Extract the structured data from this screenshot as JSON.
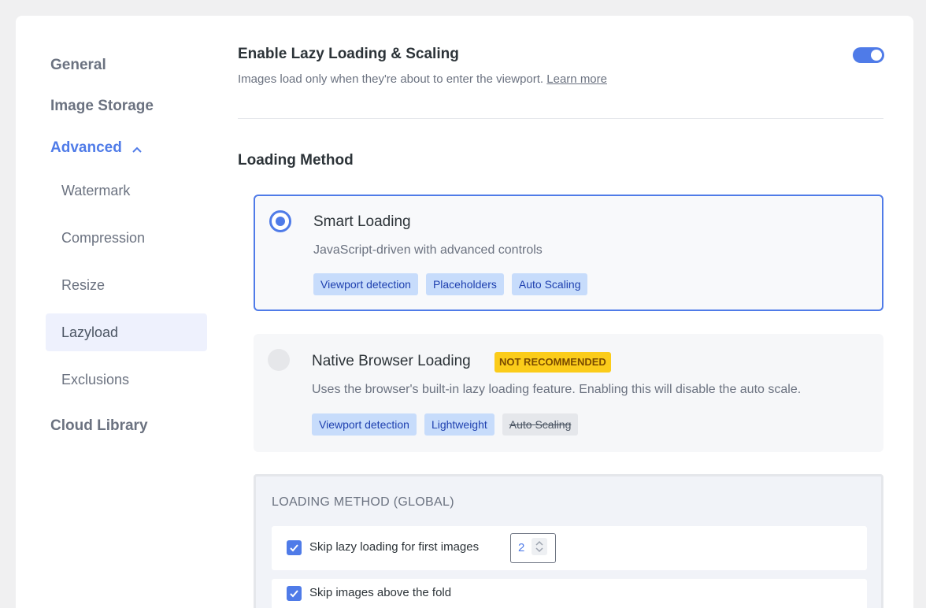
{
  "sidebar": {
    "general": "General",
    "image_storage": "Image Storage",
    "advanced": "Advanced",
    "sub_items": [
      "Watermark",
      "Compression",
      "Resize",
      "Lazyload",
      "Exclusions"
    ],
    "selected_sub_item": "Lazyload",
    "cloud_library": "Cloud Library"
  },
  "main": {
    "title": "Enable Lazy Loading & Scaling",
    "subtitle": "Images load only when they're about to enter the viewport.",
    "learn_more": "Learn more",
    "toggle_on": true,
    "section_title": "Loading Method",
    "options": [
      {
        "title": "Smart Loading",
        "description": "JavaScript-driven with advanced controls",
        "selected": true,
        "tags": [
          "Viewport detection",
          "Placeholders",
          "Auto Scaling"
        ]
      },
      {
        "title": "Native Browser Loading",
        "badge": "NOT RECOMMENDED",
        "description": "Uses the browser's built-in lazy loading feature. Enabling this will disable the auto scale.",
        "selected": false,
        "tags": [
          "Viewport detection",
          "Lightweight",
          "Auto Scaling"
        ]
      }
    ],
    "global": {
      "title": "LOADING METHOD (GLOBAL)",
      "skip_first_label": "Skip lazy loading for first images",
      "skip_first_value": "2",
      "skip_fold_label": "Skip images above the fold"
    }
  },
  "colors": {
    "accent": "#4f7be8",
    "badge": "#fbcc1a",
    "tag_bg": "#c7dcfb"
  }
}
